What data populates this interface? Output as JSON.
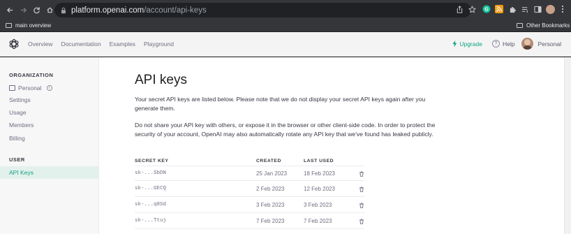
{
  "browser": {
    "url_host": "platform.openai.com",
    "url_path": "/account/api-keys",
    "bookmark_left": "main overview",
    "bookmark_right": "Other Bookmarks"
  },
  "header": {
    "nav": [
      "Overview",
      "Documentation",
      "Examples",
      "Playground"
    ],
    "upgrade": "Upgrade",
    "help": "Help",
    "help_symbol": "?",
    "account": "Personal",
    "accent": "#10a37f"
  },
  "sidebar": {
    "org_title": "ORGANIZATION",
    "org_items": [
      "Personal",
      "Settings",
      "Usage",
      "Members",
      "Billing"
    ],
    "org_info_symbol": "i",
    "user_title": "USER",
    "user_items": [
      "API Keys"
    ]
  },
  "main": {
    "title": "API keys",
    "para1": "Your secret API keys are listed below. Please note that we do not display your secret API keys again after you generate them.",
    "para2": "Do not share your API key with others, or expose it in the browser or other client-side code. In order to protect the security of your account, OpenAI may also automatically rotate any API key that we've found has leaked publicly.",
    "table": {
      "headers": [
        "SECRET KEY",
        "CREATED",
        "LAST USED"
      ],
      "rows": [
        {
          "key": "sk-...SbDN",
          "created": "25 Jan 2023",
          "last_used": "18 Feb 2023"
        },
        {
          "key": "sk-...GECQ",
          "created": "2 Feb 2023",
          "last_used": "12 Feb 2023"
        },
        {
          "key": "sk-...q8Sd",
          "created": "3 Feb 2023",
          "last_used": "3 Feb 2023"
        },
        {
          "key": "sk-...Ttuj",
          "created": "7 Feb 2023",
          "last_used": "7 Feb 2023"
        }
      ]
    }
  }
}
